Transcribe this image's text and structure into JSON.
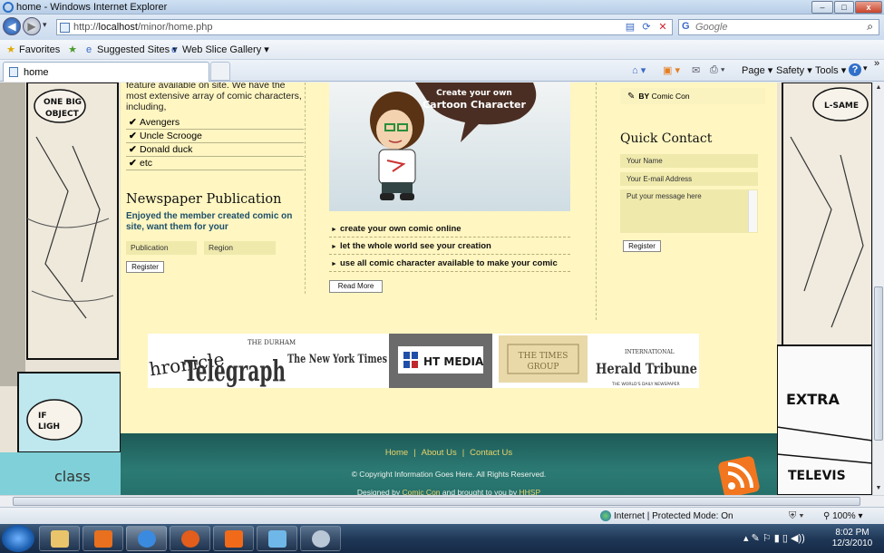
{
  "window": {
    "title": "home - Windows Internet Explorer",
    "controls": {
      "minimize": "–",
      "maximize": "□",
      "close": "x"
    }
  },
  "addressbar": {
    "url_prefix": "http://",
    "url_host": "localhost",
    "url_path": "/minor/home.php",
    "search_placeholder": "Google"
  },
  "favorites_bar": {
    "favorites_label": "Favorites",
    "suggested_label": "Suggested Sites ▾",
    "gallery_label": "Web Slice Gallery ▾"
  },
  "tabs": [
    {
      "label": "home"
    }
  ],
  "command_bar": {
    "page_label": "Page ▾",
    "safety_label": "Safety ▾",
    "tools_label": "Tools ▾",
    "help_label": "?",
    "more": "»"
  },
  "left_column": {
    "intro": "feature available on site. We have the most extensive array of comic characters, including,",
    "characters": [
      "Avengers",
      "Uncle Scrooge",
      "Donald duck",
      "etc"
    ],
    "newspaper_heading": "Newspaper Publication",
    "newspaper_blurb": "Enjoyed the member created comic on site, want them for your",
    "publication_placeholder": "Publication",
    "region_placeholder": "Region",
    "register_label": "Register"
  },
  "middle_column": {
    "banner_line1": "Create your own",
    "banner_line2": "Cartoon Character",
    "features": [
      "create your own comic online",
      "let the whole world see your creation",
      "use all comic character available to make your comic"
    ],
    "read_more_label": "Read More"
  },
  "right_column": {
    "by_label": "BY",
    "by_author": "Comic Con",
    "quick_contact_heading": "Quick Contact",
    "name_placeholder": "Your Name",
    "email_placeholder": "Your E-mail Address",
    "message_placeholder": "Put your message here",
    "register_label": "Register"
  },
  "partners": {
    "chronicle": "hronicle",
    "telegraph_small": "THE DURHAM",
    "telegraph": "Telegraph",
    "nyt": "The New York Times",
    "ht": "HT MEDIA",
    "times_group1": "THE TIMES",
    "times_group2": "GROUP",
    "iht_small": "INTERNATIONAL",
    "iht": "Herald Tribune",
    "iht_tag": "THE WORLD'S DAILY NEWSPAPER"
  },
  "footer": {
    "links": [
      "Home",
      "About Us",
      "Contact Us"
    ],
    "separator": "|",
    "copyright": "© Copyright Information Goes Here. All Rights Reserved.",
    "designed_prefix": "Designed by",
    "designed_by": "Comic Con",
    "designed_mid": "and brought to you by",
    "brought_by": "HHSP"
  },
  "statusbar": {
    "zone": "Internet | Protected Mode: On",
    "zoom": "100%"
  },
  "taskbar": {
    "time": "8:02 PM",
    "date": "12/3/2010"
  },
  "comic_panels": {
    "left_bubble1": "ONE BIG",
    "left_bubble2": "OBJECT",
    "left_lower1": "IF",
    "left_lower2": "LIGH",
    "left_bottom": "class",
    "right_top": "L-SAME",
    "right_extra": "EXTRA",
    "right_tv": "TELEVIS"
  },
  "colors": {
    "page_bg": "#fff6c1",
    "input_bg": "#efe9ac",
    "footer_teal": "#2c7a74",
    "footer_link": "#e8d46a",
    "heading_teal": "#1b4f6b"
  }
}
